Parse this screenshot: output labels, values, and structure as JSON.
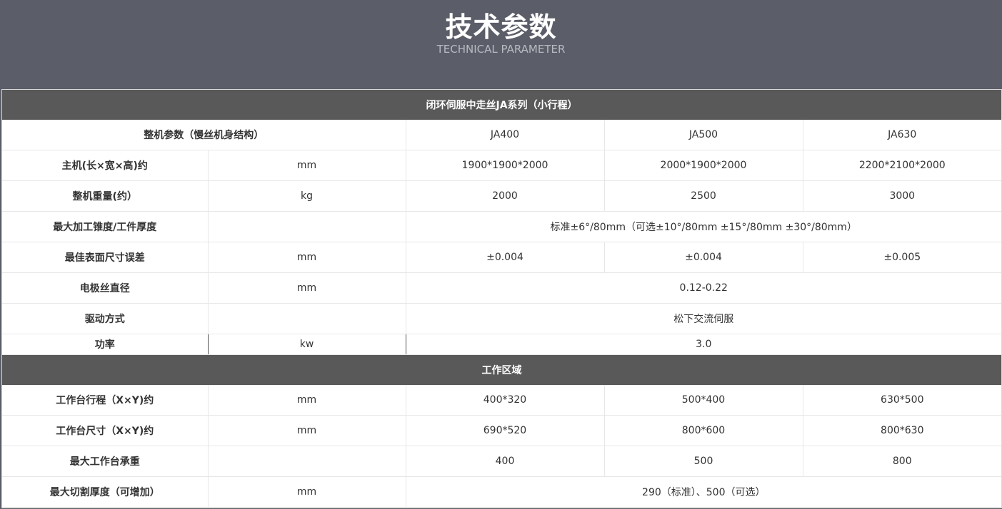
{
  "header": {
    "title": "技术参数",
    "subtitle": "TECHNICAL PARAMETER"
  },
  "section1": {
    "title": "闭环伺服中走丝JA系列（小行程）",
    "model_header": {
      "label": "整机参数（慢丝机身结构）",
      "models": [
        "JA400",
        "JA500",
        "JA630"
      ]
    },
    "rows": [
      {
        "label": "主机(长×宽×高)约",
        "unit": "mm",
        "values": [
          "1900*1900*2000",
          "2000*1900*2000",
          "2200*2100*2000"
        ]
      },
      {
        "label": "整机重量(约）",
        "unit": "kg",
        "values": [
          "2000",
          "2500",
          "3000"
        ]
      },
      {
        "label": "最大加工锥度/工件厚度",
        "unit": "",
        "merged": "标准±6°/80mm（可选±10°/80mm  ±15°/80mm  ±30°/80mm）"
      },
      {
        "label": "最佳表面尺寸误差",
        "unit": "mm",
        "values": [
          "±0.004",
          "±0.004",
          "±0.005"
        ]
      },
      {
        "label": "电极丝直径",
        "unit": "mm",
        "merged": "0.12-0.22"
      },
      {
        "label": "驱动方式",
        "unit": "",
        "merged": "松下交流伺服"
      },
      {
        "label": "功率",
        "unit": "kw",
        "merged": "3.0"
      }
    ]
  },
  "section2": {
    "title": "工作区域",
    "rows": [
      {
        "label": "工作台行程（X×Y)约",
        "unit": "mm",
        "values": [
          "400*320",
          "500*400",
          "630*500"
        ]
      },
      {
        "label": "工作台尺寸（X×Y)约",
        "unit": "mm",
        "values": [
          "690*520",
          "800*600",
          "800*630"
        ]
      },
      {
        "label": "最大工作台承重",
        "unit": "",
        "values": [
          "400",
          "500",
          "800"
        ]
      },
      {
        "label": "最大切割厚度（可增加）",
        "unit": "mm",
        "merged": "290（标准）、500（可选）"
      }
    ]
  }
}
